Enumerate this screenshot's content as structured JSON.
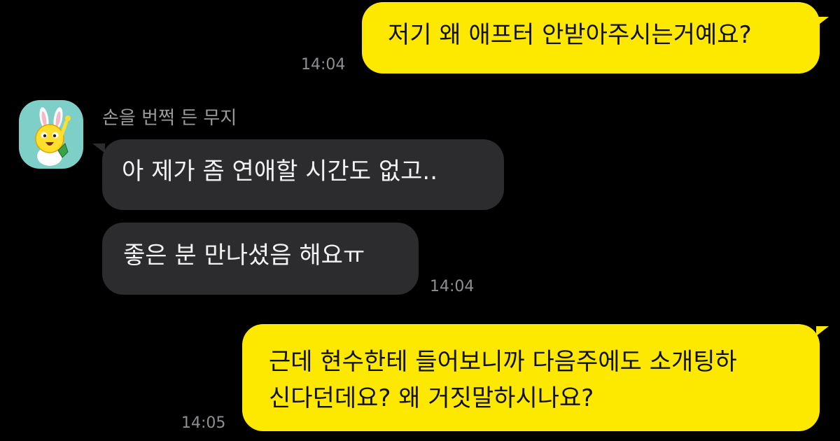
{
  "messages": [
    {
      "id": "m1",
      "direction": "sent",
      "text": "저기 왜 애프터 안받아주시는거예요?",
      "time": "14:04"
    },
    {
      "id": "m2",
      "direction": "received",
      "sender": "손을 번쩍 든 무지",
      "text": "아 제가 좀 연애할 시간도 없고.."
    },
    {
      "id": "m3",
      "direction": "received",
      "text": "좋은 분 만나셨음 해요ㅠ",
      "time": "14:04"
    },
    {
      "id": "m4",
      "direction": "sent",
      "lines": [
        "근데 현수한테 들어보니까 다음주에도 소개팅하",
        "신다던데요? 왜 거짓말하시나요?"
      ],
      "time": "14:05"
    }
  ],
  "avatar_icon": "muzi-character-icon",
  "colors": {
    "sent_bubble": "#fde800",
    "received_bubble": "#2c2c2e",
    "background": "#000000",
    "timestamp": "#8e8e93",
    "avatar_bg": "#7dcfc8"
  }
}
